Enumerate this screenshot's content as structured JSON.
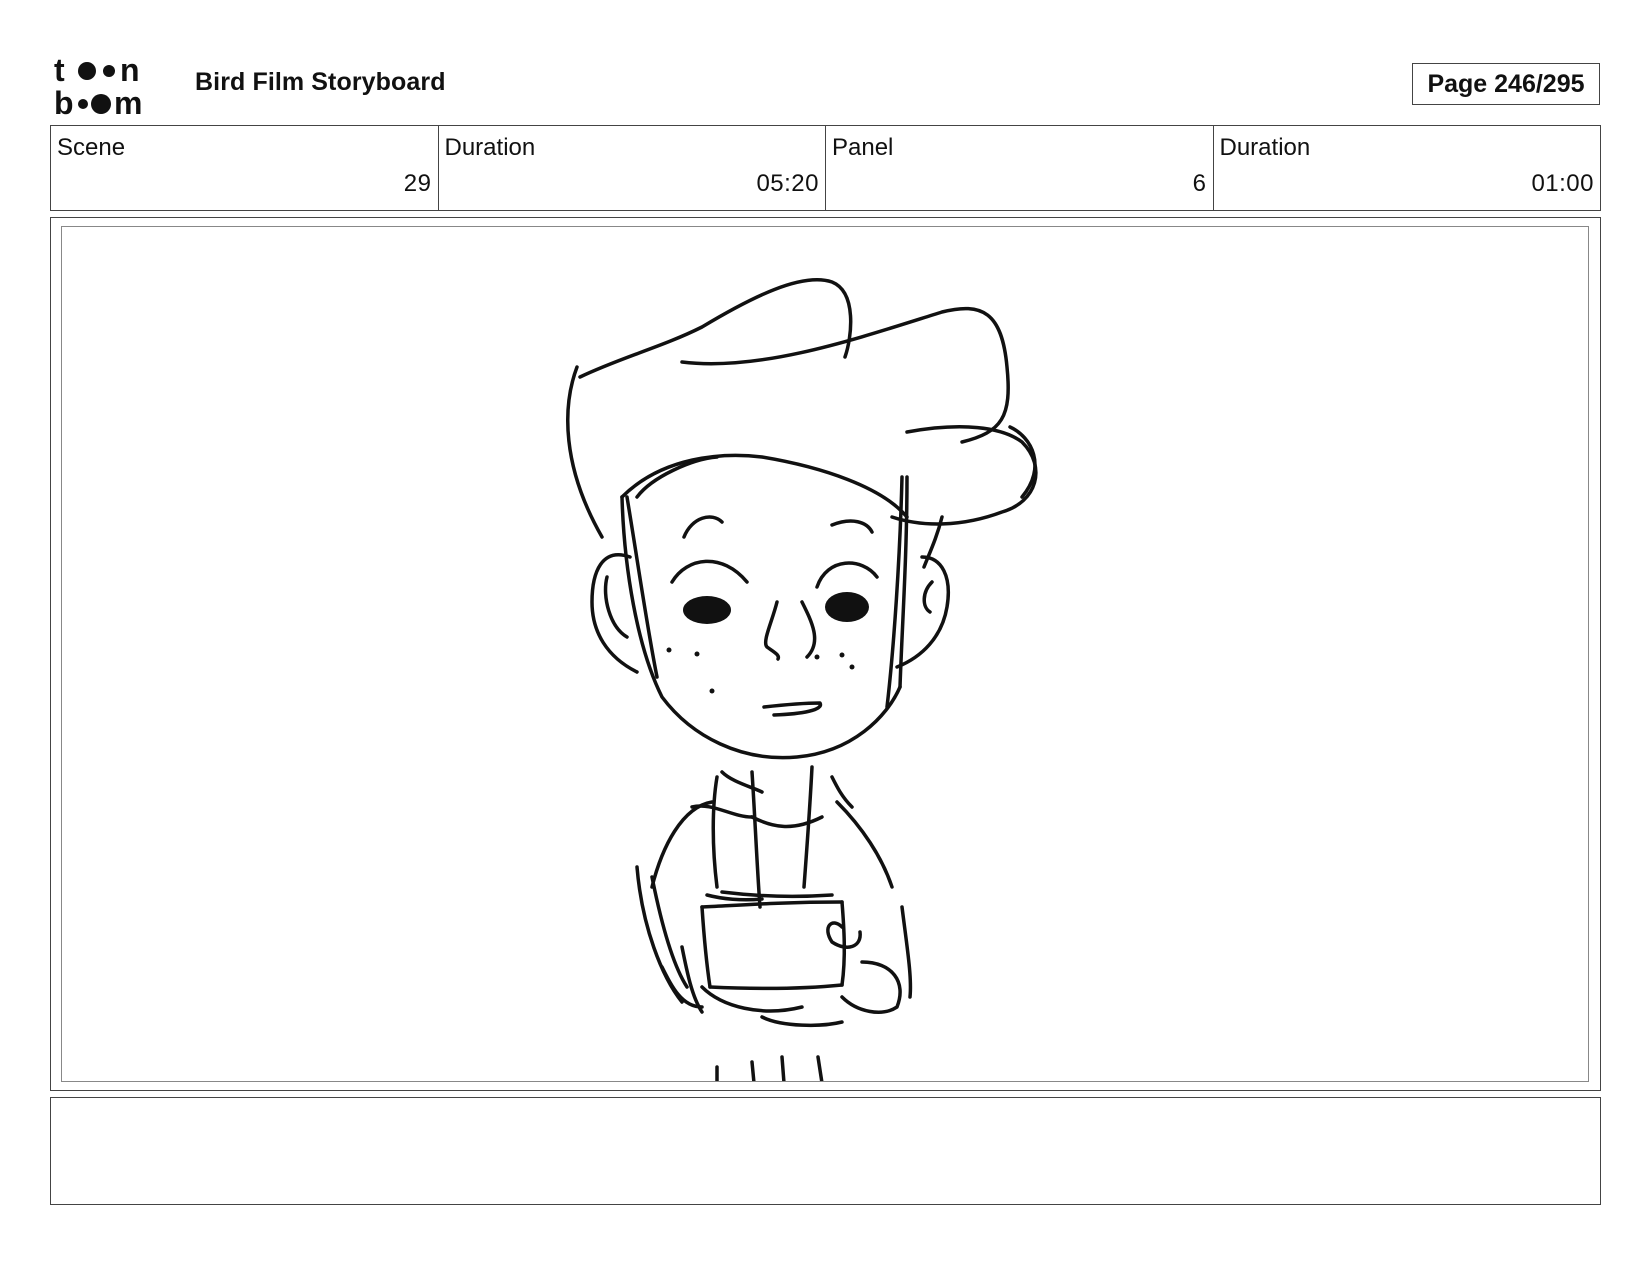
{
  "header": {
    "logo_text": "toon boom",
    "title": "Bird Film Storyboard",
    "page_indicator": "Page 246/295"
  },
  "info": [
    {
      "label": "Scene",
      "value": "29"
    },
    {
      "label": "Duration",
      "value": "05:20"
    },
    {
      "label": "Panel",
      "value": "6"
    },
    {
      "label": "Duration",
      "value": "01:00"
    }
  ],
  "panel": {
    "image_alt": "pencil sketch of boy holding a box"
  },
  "notes": {
    "text": ""
  }
}
